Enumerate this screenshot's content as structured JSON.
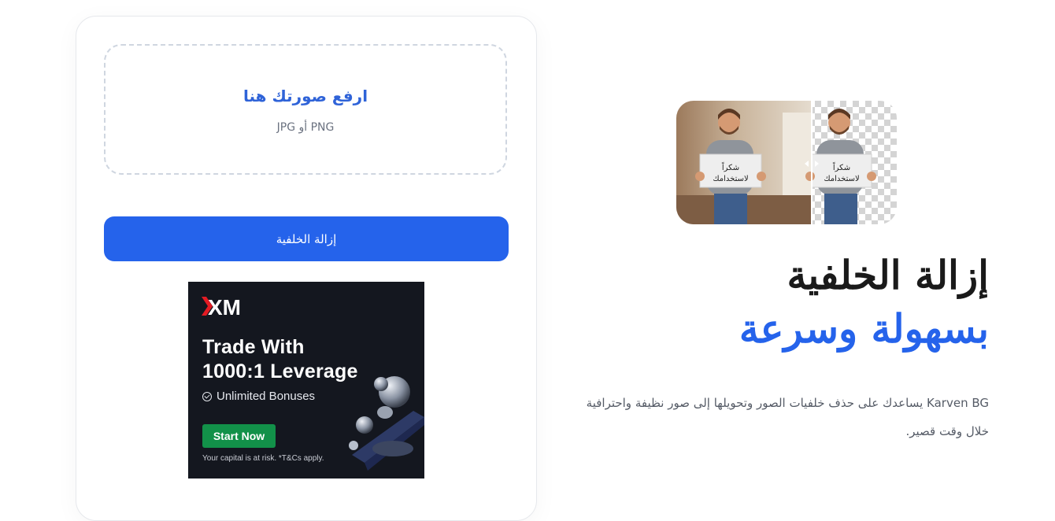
{
  "upload": {
    "title": "ارفع صورتك هنا",
    "formats": "PNG أو JPG"
  },
  "actions": {
    "remove_label": "إزالة الخلفية"
  },
  "ad": {
    "brand": "XM",
    "headline_1": "Trade With",
    "headline_2": "1000:1 Leverage",
    "bonus": "Unlimited Bonuses",
    "cta": "Start Now",
    "disclaimer": "Your capital is at risk. *T&Cs apply.",
    "brand_color": "#e31b23",
    "cta_color": "#129149"
  },
  "hero": {
    "sign_line_1": "شكراً",
    "sign_line_2": "لاستخدامك",
    "title_line_1": "إزالة الخلفية",
    "title_line_2": "بسهولة وسرعة",
    "description": "Karven BG يساعدك على حذف خلفيات الصور وتحويلها إلى صور نظيفة واحترافية خلال وقت قصير."
  },
  "colors": {
    "accent": "#2563eb",
    "heading": "#1a1a1a",
    "muted": "#6b7280"
  }
}
